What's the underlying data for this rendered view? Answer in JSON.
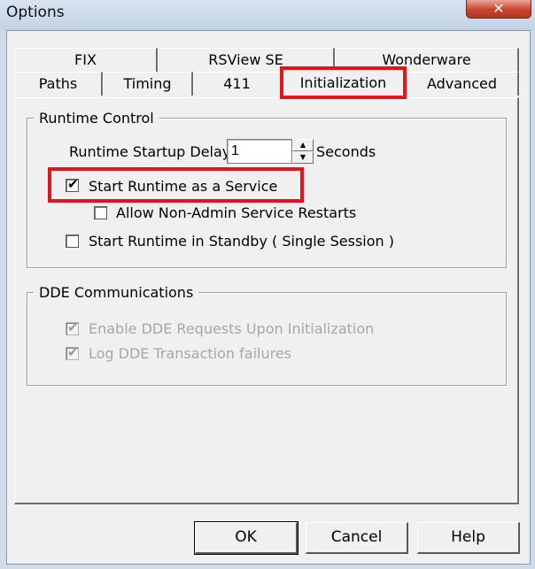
{
  "window": {
    "title": "Options",
    "close_glyph": "✕"
  },
  "tabs": {
    "row1": [
      {
        "label": "FIX"
      },
      {
        "label": "RSView SE"
      },
      {
        "label": "Wonderware"
      }
    ],
    "row2": [
      {
        "label": "Paths"
      },
      {
        "label": "Timing"
      },
      {
        "label": "411"
      },
      {
        "label": "Initialization",
        "active": true
      },
      {
        "label": "Advanced"
      }
    ]
  },
  "runtime_control": {
    "group_label": "Runtime Control",
    "startup_delay_label": "Runtime Startup Delay:",
    "startup_delay_value": "1",
    "startup_delay_unit": "Seconds",
    "start_as_service": {
      "label": "Start Runtime as a Service",
      "checked": true
    },
    "allow_non_admin_restarts": {
      "label": "Allow Non-Admin Service Restarts",
      "checked": false
    },
    "start_in_standby": {
      "label": "Start Runtime in Standby ( Single Session )",
      "checked": false
    }
  },
  "dde": {
    "group_label": "DDE Communications",
    "enable_requests": {
      "label": "Enable DDE Requests Upon Initialization",
      "checked": true,
      "enabled": false
    },
    "log_failures": {
      "label": "Log DDE Transaction failures",
      "checked": true,
      "enabled": false
    }
  },
  "buttons": {
    "ok": "OK",
    "cancel": "Cancel",
    "help": "Help"
  },
  "colors": {
    "highlight": "#e4141b",
    "dialog_bg": "#f0f0f0",
    "title_bg": "#cfdbe8",
    "close_bg": "#c8442c"
  }
}
